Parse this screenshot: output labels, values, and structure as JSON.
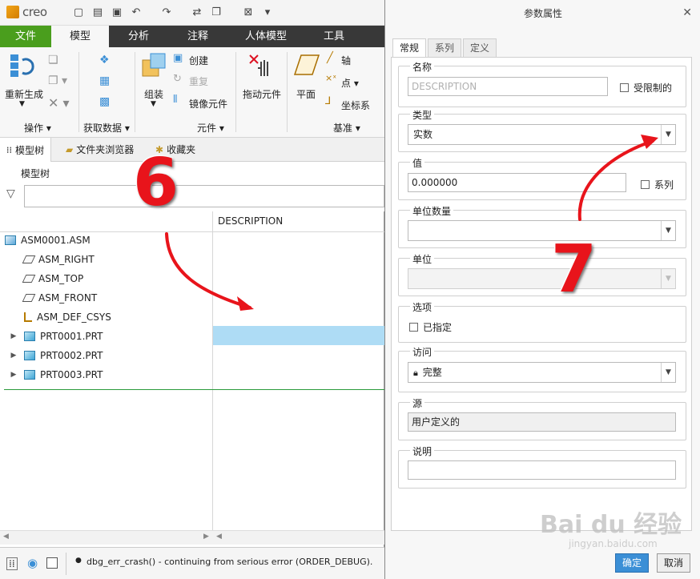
{
  "app": {
    "logo": "creo",
    "menu_tabs": [
      "文件",
      "模型",
      "分析",
      "注释",
      "人体模型",
      "工具"
    ],
    "ribbon": {
      "regenerate": "重新生成",
      "ops_group": "操作",
      "getdata_group": "获取数据",
      "assemble": "组装",
      "create": "创建",
      "repeat": "重复",
      "mirror_component": "镜像元件",
      "component_group": "元件",
      "drag_component": "拖动元件",
      "plane": "平面",
      "axis": "轴",
      "point": "点",
      "csys": "坐标系",
      "datum_group": "基准"
    },
    "panel_tabs": [
      "模型树",
      "文件夹浏览器",
      "收藏夹"
    ],
    "tree_title": "模型树",
    "column_header": "DESCRIPTION",
    "tree_rows": [
      "ASM0001.ASM",
      "ASM_RIGHT",
      "ASM_TOP",
      "ASM_FRONT",
      "ASM_DEF_CSYS",
      "PRT0001.PRT",
      "PRT0002.PRT",
      "PRT0003.PRT"
    ],
    "status_message": "dbg_err_crash() - continuing from serious error (ORDER_DEBUG)."
  },
  "dialog": {
    "title": "参数属性",
    "tabs": [
      "常规",
      "系列",
      "定义"
    ],
    "name_label": "名称",
    "name_placeholder": "DESCRIPTION",
    "restricted_label": "受限制的",
    "type_label": "类型",
    "type_value": "实数",
    "value_label": "值",
    "value_value": "0.000000",
    "family_label": "系列",
    "unit_quantity_label": "单位数量",
    "unit_label": "单位",
    "options_label": "选项",
    "specified_label": "已指定",
    "access_label": "访问",
    "access_value": "完整",
    "source_label": "源",
    "source_value": "用户定义的",
    "description_label": "说明",
    "ok_button": "确定",
    "cancel_button": "取消"
  },
  "annotations": {
    "step6": "6",
    "step7": "7",
    "arrow_color": "#e8141b"
  },
  "watermark": {
    "brand": "Bai du 经验",
    "url": "jingyan.baidu.com"
  },
  "colors": {
    "file_tab": "#4a9e1d",
    "menubar": "#383838",
    "selection": "#aedcf5",
    "ok_button": "#3b8fd6"
  }
}
